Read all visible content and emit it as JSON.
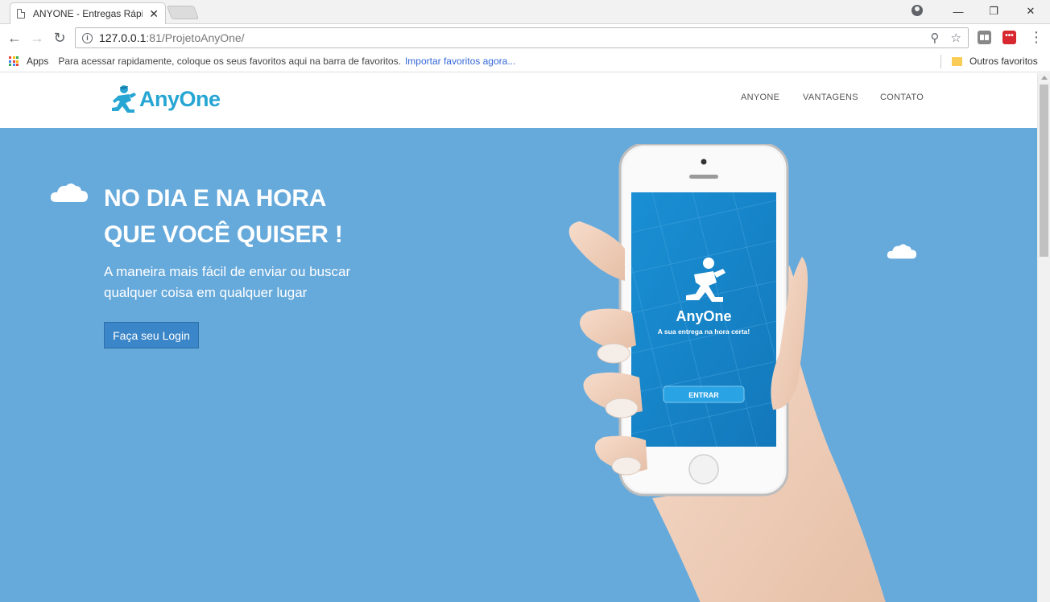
{
  "browser": {
    "tab_title": "ANYONE - Entregas Rápidas",
    "url_host": "127.0.0.1",
    "url_rest": ":81/ProjetoAnyOne/",
    "bookmarks": {
      "apps_label": "Apps",
      "hint": "Para acessar rapidamente, coloque os seus favoritos aqui na barra de favoritos.",
      "import_link": "Importar favoritos agora...",
      "other_folder": "Outros favoritos"
    },
    "ext_red_label": "•••"
  },
  "site": {
    "logo_text": "AnyOne",
    "nav": [
      "ANYONE",
      "VANTAGENS",
      "CONTATO"
    ],
    "hero": {
      "title_line1": "NO DIA E NA HORA",
      "title_line2": "QUE VOCÊ QUISER !",
      "subtitle_line1": "A maneira mais fácil de enviar ou buscar",
      "subtitle_line2": "qualquer coisa em qualquer lugar",
      "login_button": "Faça seu Login"
    },
    "phone_screen": {
      "app_name": "AnyOne",
      "tagline": "A sua entrega na hora certa!",
      "enter_button": "ENTRAR"
    }
  },
  "colors": {
    "hero_bg": "#66a9db",
    "logo_blue": "#27a6d3",
    "button_blue": "#3b86c8",
    "phone_screen": "#1d8fd0"
  }
}
